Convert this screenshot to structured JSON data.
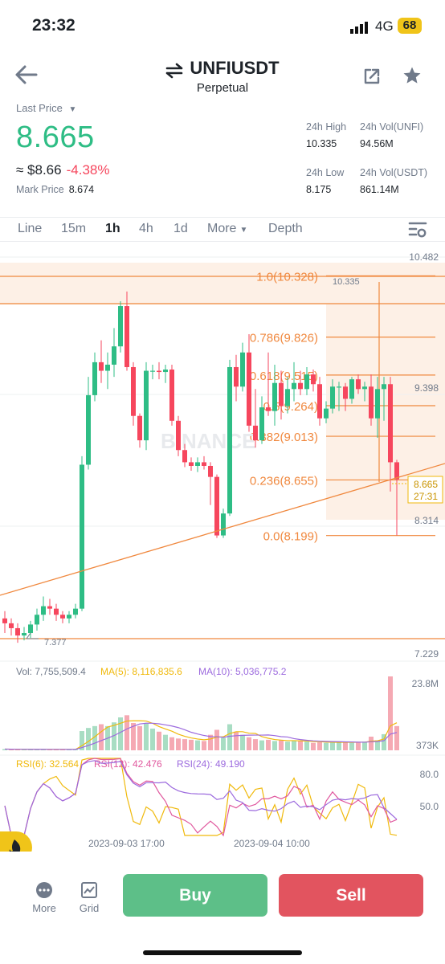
{
  "status": {
    "time": "23:32",
    "network": "4G",
    "battery": "68"
  },
  "header": {
    "symbol": "UNFIUSDT",
    "subtitle": "Perpetual"
  },
  "ticker": {
    "last_price_label": "Last Price",
    "last_price": "8.665",
    "fiat_price": "≈ $8.66",
    "change": "-4.38%",
    "mark_price_label": "Mark Price",
    "mark_price": "8.674",
    "high_label": "24h High",
    "high": "10.335",
    "low_label": "24h Low",
    "low": "8.175",
    "vol_base_label": "24h Vol(UNFI)",
    "vol_base": "94.56M",
    "vol_quote_label": "24h Vol(USDT)",
    "vol_quote": "861.14M"
  },
  "tabs": [
    "Line",
    "15m",
    "1h",
    "4h",
    "1d",
    "More",
    "Depth"
  ],
  "active_tab": "1h",
  "chart_data": {
    "type": "candlestick",
    "price_axis": [
      "10.482",
      "9.398",
      "8.314",
      "7.229"
    ],
    "current_price": "8.665",
    "countdown": "27:31",
    "high_marker": "10.335",
    "low_marker": "7.377",
    "fib_levels": [
      {
        "label": "1.0(10.328)",
        "value": 10.328
      },
      {
        "label": "0.786(9.826)",
        "value": 9.826
      },
      {
        "label": "0.618(9.515)",
        "value": 9.515
      },
      {
        "label": "0.5(9.264)",
        "value": 9.264
      },
      {
        "label": "0.382(9.013)",
        "value": 9.013
      },
      {
        "label": "0.236(8.655)",
        "value": 8.655
      },
      {
        "label": "0.0(8.199)",
        "value": 8.199
      }
    ],
    "candles": [
      [
        7.52,
        7.48,
        7.58,
        7.4
      ],
      [
        7.48,
        7.44,
        7.52,
        7.38
      ],
      [
        7.44,
        7.38,
        7.48,
        7.32
      ],
      [
        7.38,
        7.4,
        7.45,
        7.34
      ],
      [
        7.4,
        7.47,
        7.5,
        7.36
      ],
      [
        7.47,
        7.55,
        7.6,
        7.42
      ],
      [
        7.55,
        7.62,
        7.7,
        7.5
      ],
      [
        7.62,
        7.6,
        7.68,
        7.55
      ],
      [
        7.6,
        7.55,
        7.64,
        7.5
      ],
      [
        7.55,
        7.52,
        7.58,
        7.48
      ],
      [
        7.52,
        7.55,
        7.58,
        7.48
      ],
      [
        7.55,
        7.6,
        7.64,
        7.52
      ],
      [
        7.6,
        8.78,
        8.85,
        7.58
      ],
      [
        8.78,
        9.35,
        9.5,
        8.74
      ],
      [
        9.35,
        9.62,
        9.7,
        9.3
      ],
      [
        9.62,
        9.55,
        9.8,
        9.45
      ],
      [
        9.55,
        9.6,
        9.7,
        9.4
      ],
      [
        9.6,
        9.75,
        9.9,
        9.5
      ],
      [
        9.75,
        10.08,
        10.12,
        9.7
      ],
      [
        10.08,
        9.58,
        10.2,
        9.55
      ],
      [
        9.58,
        9.18,
        9.62,
        9.1
      ],
      [
        9.18,
        8.98,
        9.2,
        8.92
      ],
      [
        8.98,
        9.55,
        9.62,
        8.9
      ],
      [
        9.55,
        9.55,
        9.6,
        9.48
      ],
      [
        9.55,
        9.54,
        9.62,
        9.48
      ],
      [
        9.54,
        9.56,
        9.6,
        9.45
      ],
      [
        9.56,
        9.14,
        9.6,
        9.1
      ],
      [
        9.14,
        8.9,
        9.18,
        8.85
      ],
      [
        8.9,
        8.8,
        8.95,
        8.76
      ],
      [
        8.8,
        8.77,
        8.84,
        8.73
      ],
      [
        8.77,
        8.8,
        8.84,
        8.72
      ],
      [
        8.8,
        8.77,
        8.85,
        8.74
      ],
      [
        8.77,
        8.68,
        8.8,
        8.45
      ],
      [
        8.68,
        8.2,
        8.7,
        8.18
      ],
      [
        8.2,
        8.38,
        8.42,
        8.18
      ],
      [
        8.38,
        9.58,
        9.64,
        8.36
      ],
      [
        9.58,
        9.42,
        9.68,
        9.3
      ],
      [
        9.42,
        9.7,
        9.78,
        9.38
      ],
      [
        9.7,
        9.1,
        9.85,
        9.05
      ],
      [
        9.1,
        8.98,
        9.4,
        8.92
      ],
      [
        8.98,
        9.25,
        9.34,
        8.95
      ],
      [
        9.25,
        9.22,
        9.7,
        9.18
      ],
      [
        9.22,
        9.45,
        9.6,
        9.1
      ],
      [
        9.45,
        9.26,
        9.55,
        9.15
      ],
      [
        9.26,
        9.4,
        9.5,
        9.2
      ],
      [
        9.4,
        9.45,
        9.62,
        9.3
      ],
      [
        9.45,
        9.4,
        9.55,
        9.35
      ],
      [
        9.4,
        9.52,
        9.58,
        9.35
      ],
      [
        9.52,
        9.44,
        9.56,
        9.38
      ],
      [
        9.44,
        9.16,
        9.5,
        9.1
      ],
      [
        9.16,
        9.24,
        9.3,
        9.12
      ],
      [
        9.24,
        9.42,
        9.48,
        9.2
      ],
      [
        9.42,
        9.42,
        9.46,
        9.22
      ],
      [
        9.42,
        9.32,
        9.45,
        9.22
      ],
      [
        9.32,
        9.48,
        9.5,
        9.28
      ],
      [
        9.48,
        9.4,
        9.52,
        9.36
      ],
      [
        9.4,
        9.42,
        9.46,
        9.3
      ],
      [
        9.42,
        9.16,
        9.52,
        9.1
      ],
      [
        9.16,
        9.4,
        9.5,
        9.0
      ],
      [
        9.4,
        9.44,
        9.5,
        9.14
      ],
      [
        9.44,
        8.8,
        9.5,
        8.56
      ],
      [
        8.8,
        8.66,
        8.82,
        8.2
      ]
    ],
    "volume": {
      "vol_label": "Vol: 7,755,509.4",
      "ma5_label": "MA(5): 8,116,835.6",
      "ma10_label": "MA(10): 5,036,775.2",
      "axis": [
        "23.8M",
        "373K"
      ],
      "values": [
        0.4,
        0.3,
        0.3,
        0.35,
        0.3,
        0.3,
        0.3,
        0.25,
        0.3,
        0.3,
        0.3,
        0.3,
        6.2,
        7.2,
        7.8,
        8.4,
        7.8,
        9.0,
        10.6,
        11.3,
        8.8,
        7.8,
        8.6,
        7.0,
        6.0,
        5.0,
        4.2,
        3.8,
        3.6,
        3.4,
        3.2,
        3.0,
        5.0,
        6.6,
        4.0,
        8.4,
        6.0,
        5.0,
        4.2,
        3.6,
        3.2,
        3.4,
        3.0,
        3.2,
        2.8,
        3.2,
        3.0,
        2.8,
        2.4,
        2.6,
        2.4,
        2.8,
        2.6,
        2.6,
        2.4,
        2.6,
        2.8,
        4.4,
        3.2,
        5.2,
        23.8,
        7.8
      ],
      "up": [
        true,
        false,
        false,
        true,
        true,
        true,
        true,
        false,
        false,
        false,
        true,
        true,
        true,
        true,
        true,
        false,
        true,
        true,
        true,
        false,
        false,
        false,
        true,
        true,
        false,
        true,
        false,
        false,
        false,
        false,
        true,
        false,
        false,
        false,
        true,
        true,
        false,
        true,
        false,
        false,
        true,
        false,
        true,
        false,
        true,
        true,
        false,
        true,
        false,
        false,
        true,
        true,
        true,
        false,
        true,
        false,
        true,
        false,
        true,
        true,
        false,
        false
      ]
    },
    "rsi": {
      "rsi6_label": "RSI(6): 32.564",
      "rsi12_label": "RSI(12): 42.476",
      "rsi24_label": "RSI(24): 49.190",
      "axis": [
        "80.0",
        "50.0"
      ]
    },
    "time_axis": [
      "2023-09-03 17:00",
      "2023-09-04 10:00"
    ],
    "watermark": "BINANCE"
  },
  "bottom": {
    "more_label": "More",
    "grid_label": "Grid",
    "buy_label": "Buy",
    "sell_label": "Sell"
  },
  "colors": {
    "up": "#2ebd85",
    "down": "#f6465d",
    "fib": "#f0883e",
    "ma5": "#f0b90b",
    "ma10": "#9c6ade"
  }
}
